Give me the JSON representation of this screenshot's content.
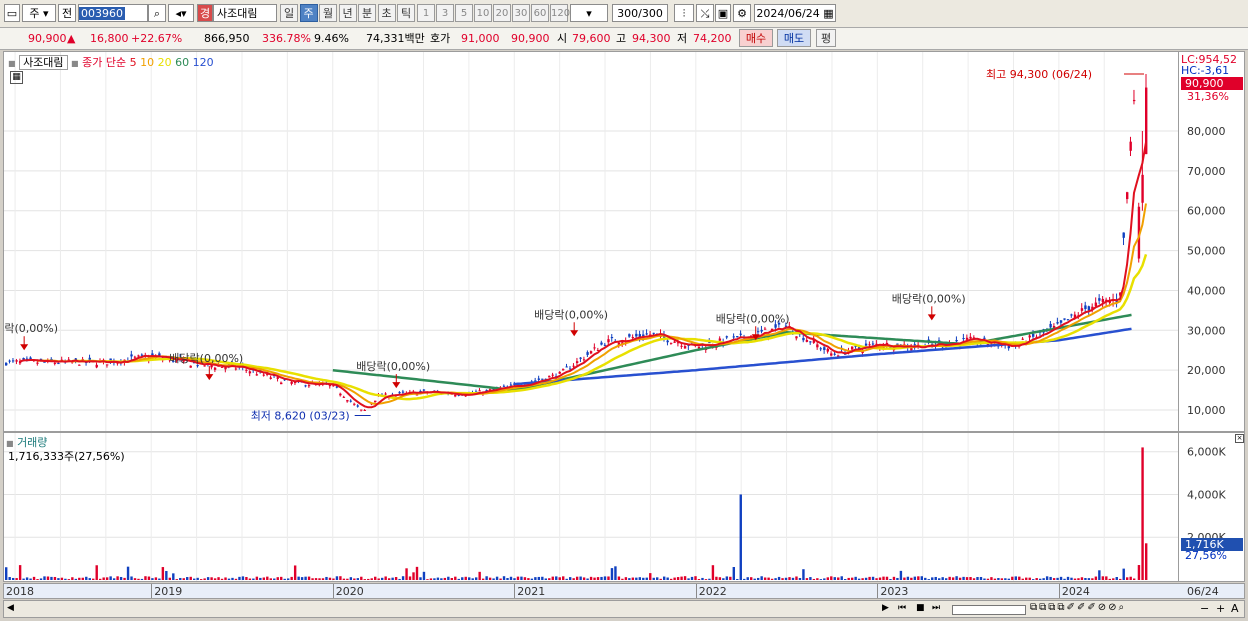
{
  "toolbar": {
    "period_type": "주",
    "prev": "전",
    "code": "003960",
    "market_badge": "경",
    "name": "사조대림",
    "periods": [
      {
        "label": "일",
        "selected": false
      },
      {
        "label": "주",
        "selected": true
      },
      {
        "label": "월",
        "selected": false
      },
      {
        "label": "년",
        "selected": false
      },
      {
        "label": "분",
        "selected": false
      },
      {
        "label": "초",
        "selected": false
      },
      {
        "label": "틱",
        "selected": false
      }
    ],
    "intervals": [
      "1",
      "3",
      "5",
      "10",
      "20",
      "30",
      "60",
      "120"
    ],
    "count": "300",
    "count_total": "/300",
    "date": "2024/06/24"
  },
  "quote": {
    "price": "90,900",
    "arrow": "▲",
    "change": "16,800",
    "change_pct": "+22.67%",
    "volume": "866,950",
    "volume_pct": "336.78%",
    "turnover": "9.46%",
    "amount": "74,331백만",
    "bid_label": "호가",
    "bid": "91,000",
    "ask": "90,900",
    "open_label": "시",
    "open": "79,600",
    "high_label": "고",
    "high": "94,300",
    "low_label": "저",
    "low": "74,200",
    "buy": "매수",
    "sell": "매도",
    "eval": "평"
  },
  "price_panel": {
    "name_tag": "사조대림",
    "legend_prefix": "종가 단순",
    "legend_periods": [
      "5",
      "10",
      "20",
      "60",
      "120"
    ],
    "legend_colors": [
      "#e0101e",
      "#f0a000",
      "#e8e000",
      "#2e8b57",
      "#2850d0"
    ],
    "lc": "LC:954,52",
    "hc": "HC:-3,61",
    "last_price": "90,900",
    "last_pct": "31,36%",
    "high_note": "최고 94,300 (06/24)",
    "low_note": "최저 8,620 (03/23)",
    "dividend_label": "배당락(0,00%)",
    "y_ticks": [
      "80,000",
      "70,000",
      "60,000",
      "50,000",
      "40,000",
      "30,000",
      "20,000",
      "10,000"
    ]
  },
  "volume_panel": {
    "title": "거래량",
    "readout": "1,716,333주(27,56%)",
    "last_volume": "1,716K",
    "last_pct": "27,56%",
    "y_ticks": [
      "6,000K",
      "4,000K",
      "2,000K"
    ]
  },
  "x_axis": {
    "labels": [
      "2018",
      "2019",
      "2020",
      "2021",
      "2022",
      "2023",
      "2024",
      "06/24"
    ]
  },
  "chart_data": {
    "type": "candlestick",
    "x_unit": "weekly",
    "x": [
      "2018-10",
      "2019-01",
      "2019-04",
      "2019-07",
      "2019-10",
      "2020-01",
      "2020-03",
      "2020-04",
      "2020-07",
      "2020-10",
      "2021-01",
      "2021-04",
      "2021-07",
      "2021-10",
      "2022-01",
      "2022-04",
      "2022-07",
      "2022-10",
      "2023-01",
      "2023-04",
      "2023-07",
      "2023-10",
      "2024-01",
      "2024-03",
      "2024-05",
      "2024-06"
    ],
    "close": [
      22000,
      23500,
      21500,
      20500,
      17000,
      16000,
      9500,
      13500,
      14500,
      14000,
      16000,
      19000,
      27000,
      29000,
      26000,
      28000,
      31000,
      24000,
      26500,
      26000,
      27500,
      26000,
      31000,
      36000,
      38000,
      90900
    ],
    "ma_60": {
      "2020-01": 20000,
      "2021-01": 15000,
      "2022-01": 25000,
      "2022-07": 29500,
      "2023-07": 26500,
      "2024-06": 34000
    },
    "ma_120": {
      "2021-01": 16500,
      "2022-01": 20000,
      "2023-01": 24000,
      "2024-01": 27500,
      "2024-06": 30500
    },
    "volume_k": {
      "2022-04": 4000,
      "2024-06": 6200,
      "2024-06 last": 1716
    },
    "ylim": [
      8000,
      94300
    ],
    "volume_ylim": [
      0,
      6500
    ]
  }
}
